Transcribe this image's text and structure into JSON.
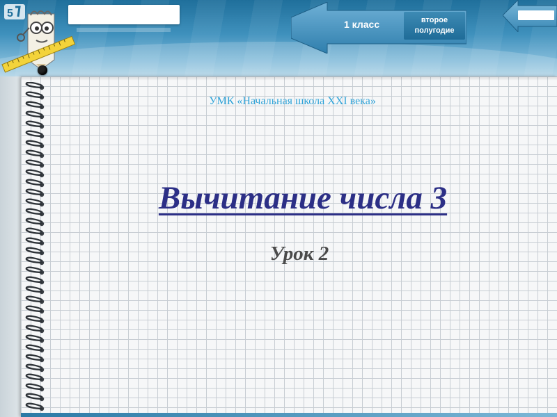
{
  "header": {
    "grade_label": "1 класс",
    "half_year_line1": "второе",
    "half_year_line2": "полугодие"
  },
  "slide": {
    "program": "УМК «Начальная школа XXI века»",
    "title": "Вычитание числа 3",
    "lesson": "Урок 2"
  },
  "colors": {
    "header_blue": "#3f91bd",
    "program_text": "#2fa3d8",
    "title_text": "#2c2f86",
    "lesson_text": "#4a4a4a"
  },
  "icons": {
    "mascot": "pencil-professor-icon",
    "logo": "logo-icon",
    "pin": "pushpin-icon",
    "rings": "spiral-binding-icon"
  }
}
